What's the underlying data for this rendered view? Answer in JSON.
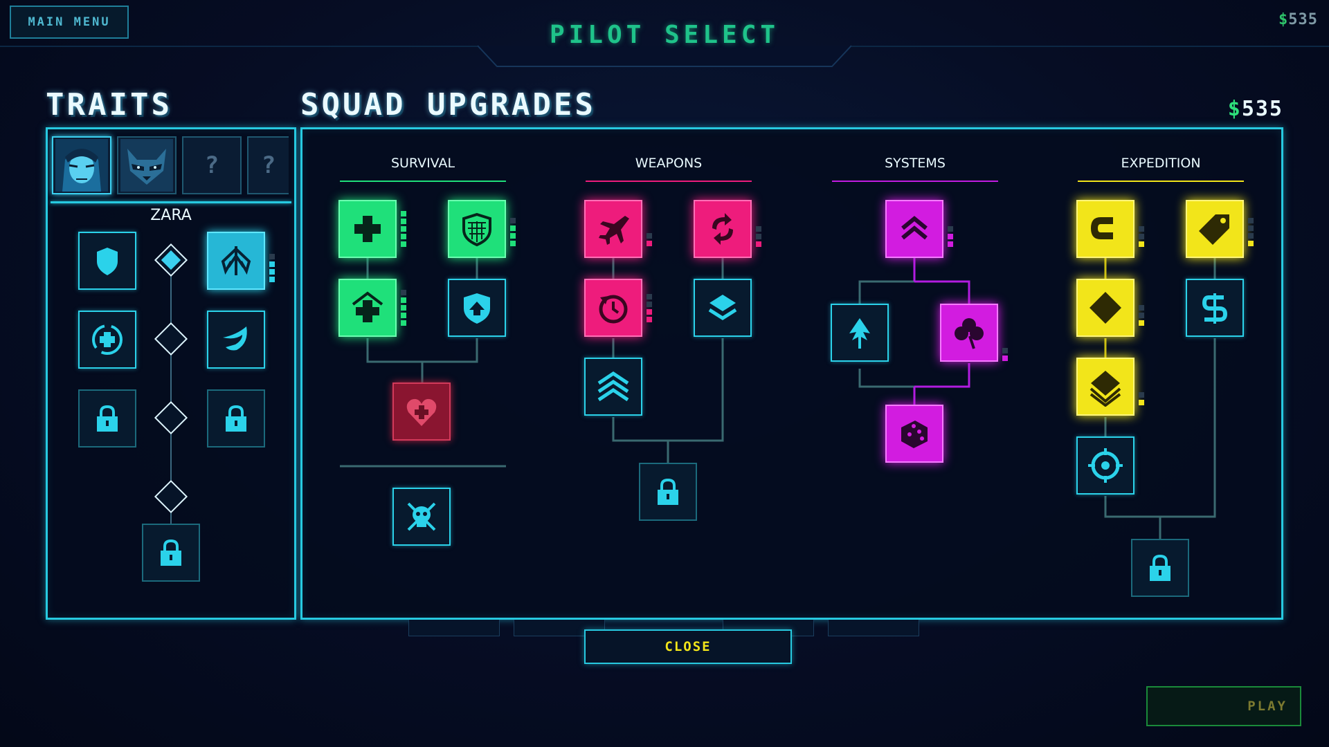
{
  "header": {
    "main_menu": "MAIN MENU",
    "title": "PILOT SELECT",
    "money": "$535"
  },
  "traits": {
    "title": "TRAITS",
    "portraits": [
      {
        "kind": "pilot",
        "name": "zara-portrait"
      },
      {
        "kind": "pilot",
        "name": "raccoon-portrait"
      },
      {
        "kind": "unknown",
        "label": "?"
      },
      {
        "kind": "unknown",
        "label": "?"
      }
    ],
    "pilot_name": "ZARA"
  },
  "upgrades": {
    "title": "SQUAD UPGRADES",
    "money": "$535",
    "categories": [
      {
        "label": "SURVIVAL",
        "color": "#1fe07a"
      },
      {
        "label": "WEAPONS",
        "color": "#ee1c7c"
      },
      {
        "label": "SYSTEMS",
        "color": "#c21ce0"
      },
      {
        "label": "EXPEDITION",
        "color": "#f2e51a"
      }
    ]
  },
  "buttons": {
    "close": "CLOSE",
    "play": "PLAY"
  },
  "colors": {
    "accent_cyan": "#27c9e0",
    "survival_green": "#1fe07a",
    "weapons_pink": "#ee1c7c",
    "systems_magenta": "#d21ce0",
    "expedition_yellow": "#f2e51a",
    "money_green": "#2ee07b"
  }
}
